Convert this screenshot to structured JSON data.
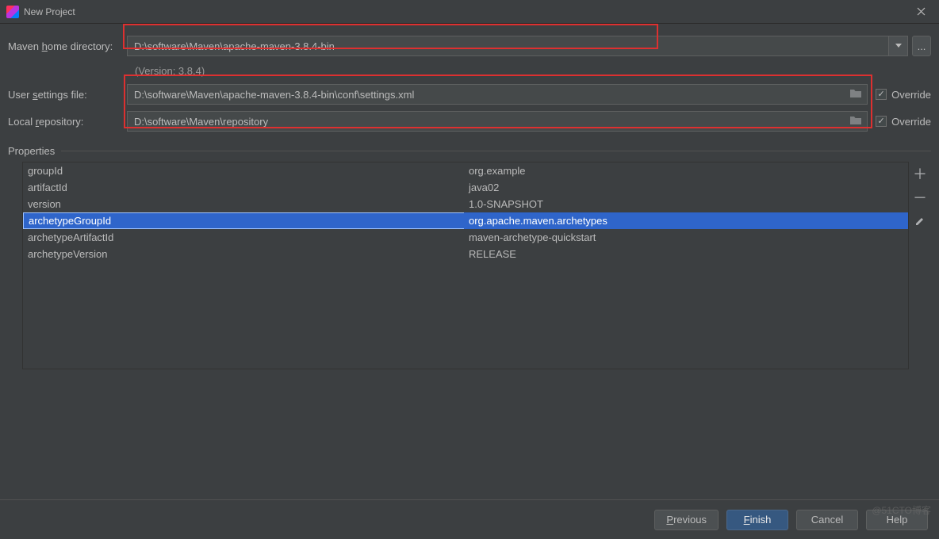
{
  "window": {
    "title": "New Project"
  },
  "labels": {
    "maven_home": "Maven home directory:",
    "user_settings": "User settings file:",
    "local_repo": "Local repository:",
    "override": "Override",
    "properties": "Properties",
    "version_hint": "(Version: 3.8.4)"
  },
  "fields": {
    "maven_home": "D:\\software\\Maven\\apache-maven-3.8.4-bin",
    "user_settings": "D:\\software\\Maven\\apache-maven-3.8.4-bin\\conf\\settings.xml",
    "local_repo": "D:\\software\\Maven\\repository"
  },
  "checks": {
    "override_settings": true,
    "override_repo": true
  },
  "properties": [
    {
      "key": "groupId",
      "value": "org.example"
    },
    {
      "key": "artifactId",
      "value": "java02"
    },
    {
      "key": "version",
      "value": "1.0-SNAPSHOT"
    },
    {
      "key": "archetypeGroupId",
      "value": "org.apache.maven.archetypes"
    },
    {
      "key": "archetypeArtifactId",
      "value": "maven-archetype-quickstart"
    },
    {
      "key": "archetypeVersion",
      "value": "RELEASE"
    }
  ],
  "selected_property_index": 3,
  "buttons": {
    "previous": "Previous",
    "finish": "Finish",
    "cancel": "Cancel",
    "help": "Help",
    "ellipsis": "..."
  },
  "watermark": "@51CTO博客"
}
